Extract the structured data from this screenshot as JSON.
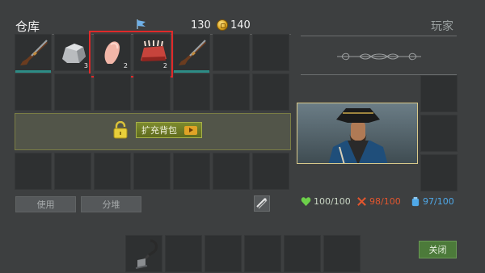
{
  "header": {
    "title": "仓库",
    "player_title": "玩家",
    "gems": "130",
    "coins": "140"
  },
  "inventory": {
    "items": [
      {
        "name": "musket",
        "count": "",
        "durability": 1.0
      },
      {
        "name": "stone",
        "count": "3"
      },
      {
        "name": "raw-meat",
        "count": "2"
      },
      {
        "name": "ribs",
        "count": "2"
      },
      {
        "name": "musket",
        "count": "",
        "durability": 1.0
      }
    ]
  },
  "expand": {
    "label": "扩充背包"
  },
  "actions": {
    "use_label": "使用",
    "split_label": "分堆"
  },
  "stats": {
    "health": "100/100",
    "hunger": "98/100",
    "thirst": "97/100",
    "health_color": "#6dd04a",
    "hunger_color": "#e2562e",
    "thirst_color": "#4fa8e8"
  },
  "hotbar": {
    "items": [
      {
        "name": "hook",
        "count": ""
      }
    ]
  },
  "close_label": "关闭"
}
